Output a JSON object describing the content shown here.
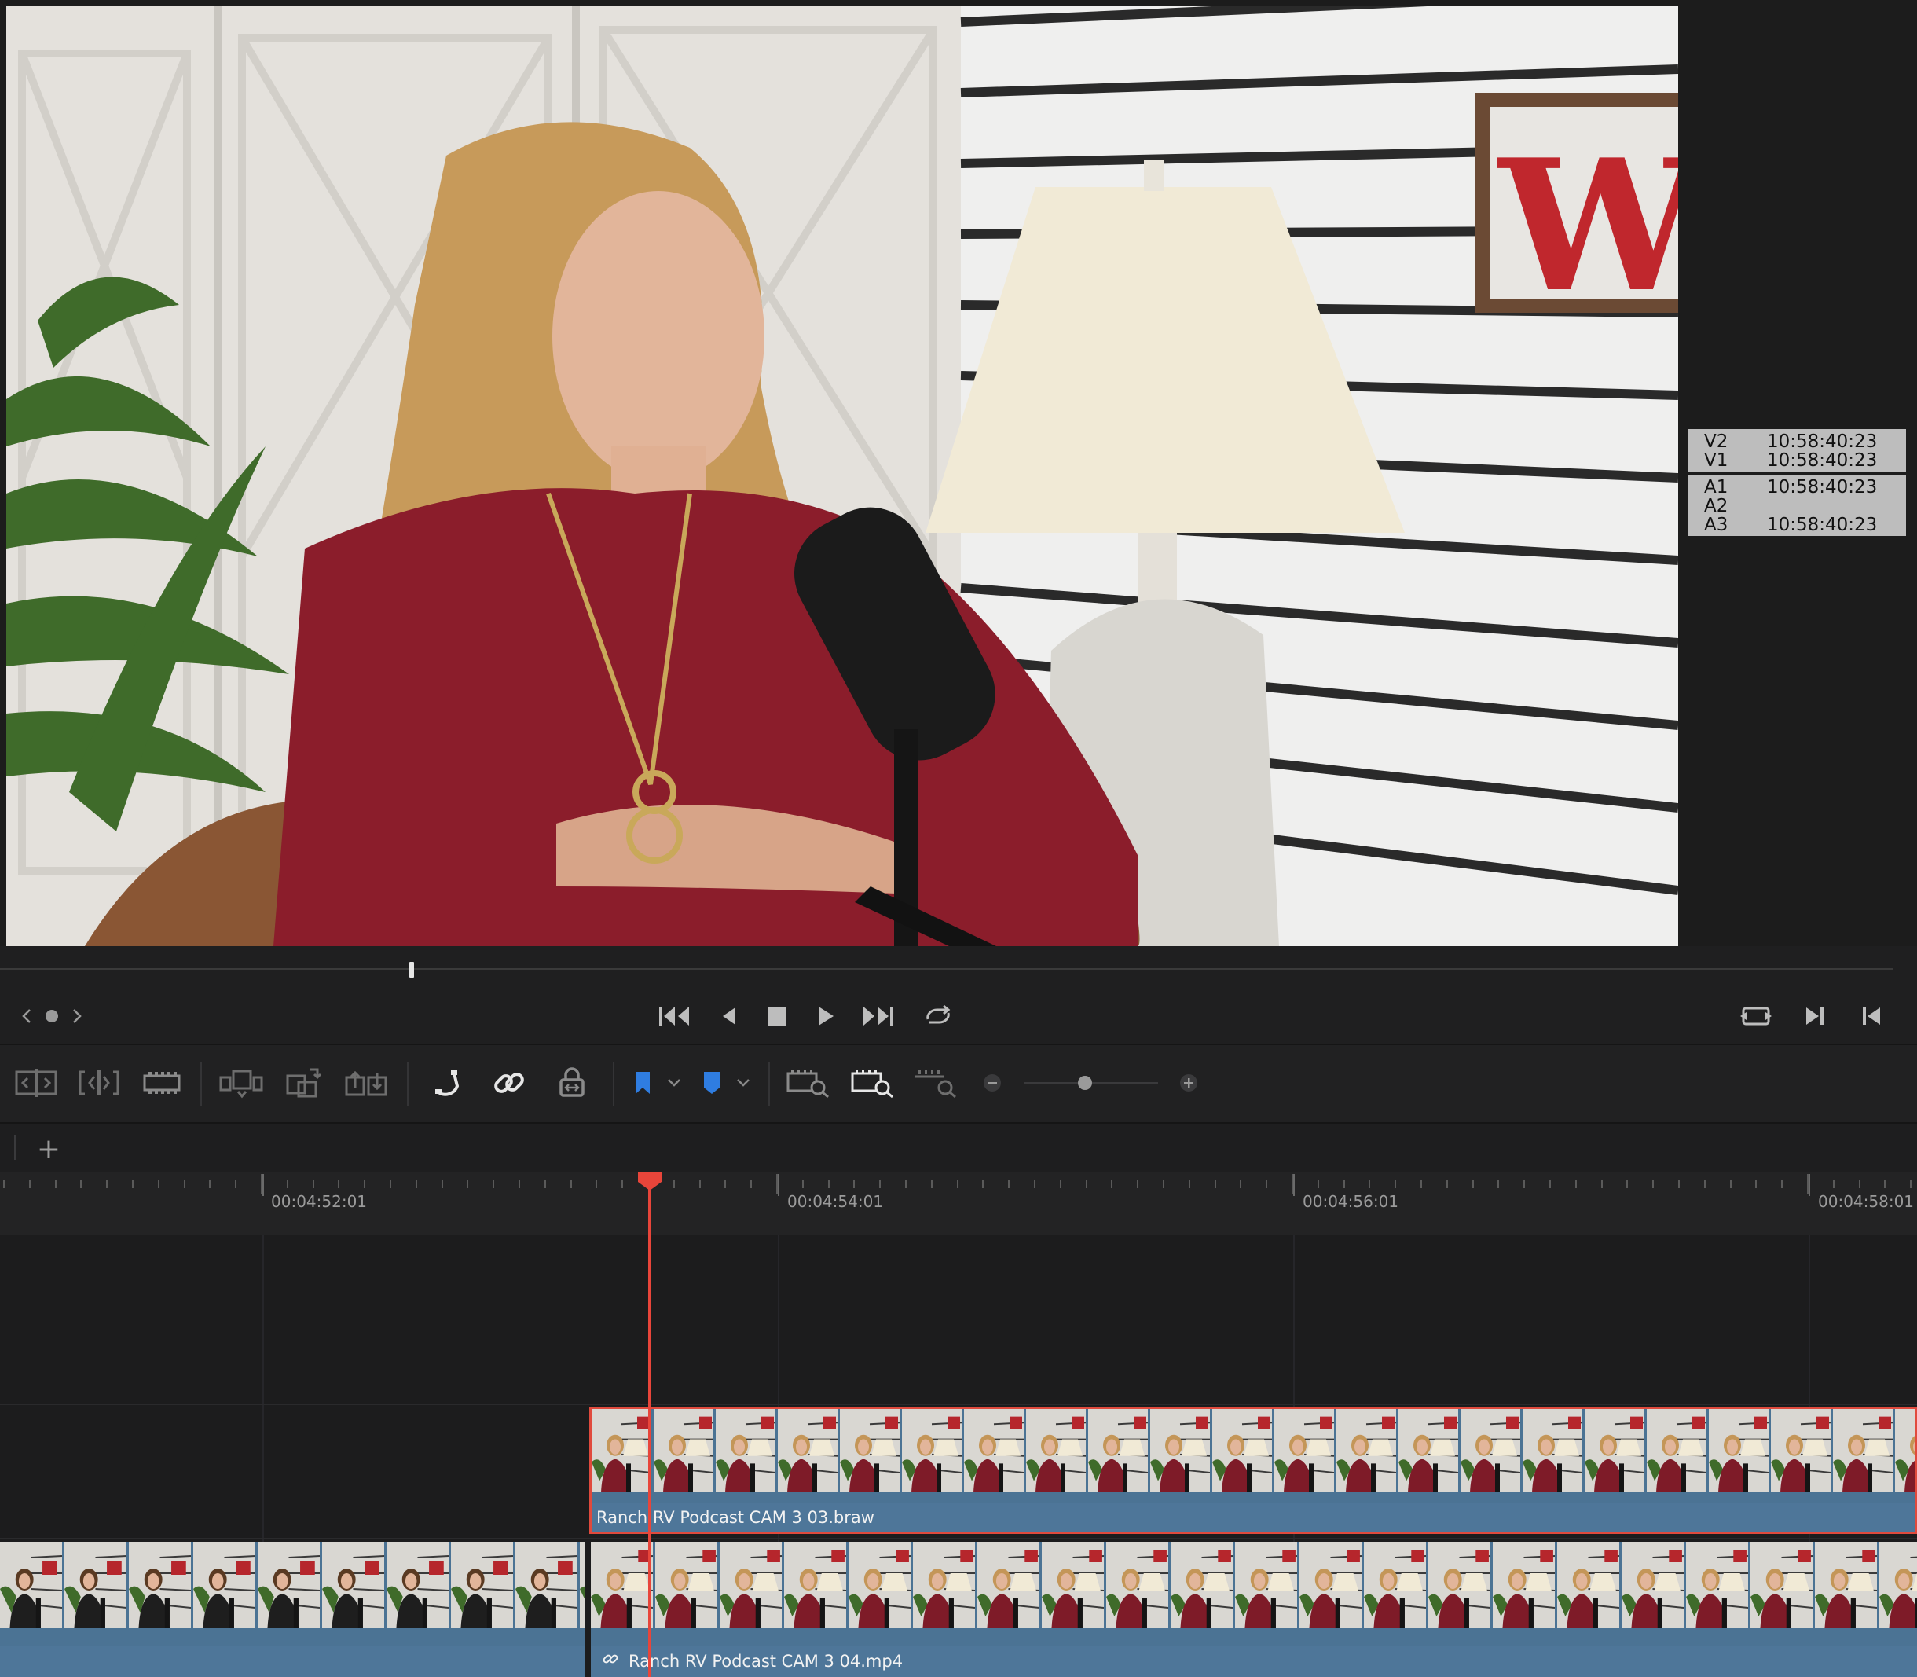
{
  "viewer": {
    "timecodes": {
      "video": [
        {
          "track": "V2",
          "tc": "10:58:40:23"
        },
        {
          "track": "V1",
          "tc": "10:58:40:23"
        }
      ],
      "audio": [
        {
          "track": "A1",
          "tc": "10:58:40:23"
        },
        {
          "track": "A2",
          "tc": ""
        },
        {
          "track": "A3",
          "tc": "10:58:40:23"
        }
      ]
    },
    "scrubber_position": 0.216
  },
  "transport": {
    "buttons": [
      "prev-clip-icon",
      "clip-dot-icon",
      "next-clip-icon",
      "jump-to-start-icon",
      "step-back-icon",
      "stop-icon",
      "play-icon",
      "jump-to-end-icon",
      "loop-icon",
      "match-frame-icon",
      "next-edit-icon",
      "prev-edit-icon"
    ]
  },
  "toolbar": {
    "zoom_level": 0.45
  },
  "tracks": {
    "add_label": "+"
  },
  "ruler": {
    "labels": [
      "00:04:52:01",
      "00:04:54:01",
      "00:04:56:01",
      "00:04:58:01"
    ]
  },
  "timeline": {
    "clips": {
      "v2": {
        "name": "Ranch RV Podcast CAM 3 03.braw"
      },
      "v1_left": {
        "name": ""
      },
      "v1_right": {
        "name": "Ranch RV Podcast CAM 3 04.mp4"
      }
    }
  },
  "colors": {
    "accent_red": "#e8453a",
    "clip_blue": "#4e7699",
    "marker_blue": "#2f7de1"
  }
}
